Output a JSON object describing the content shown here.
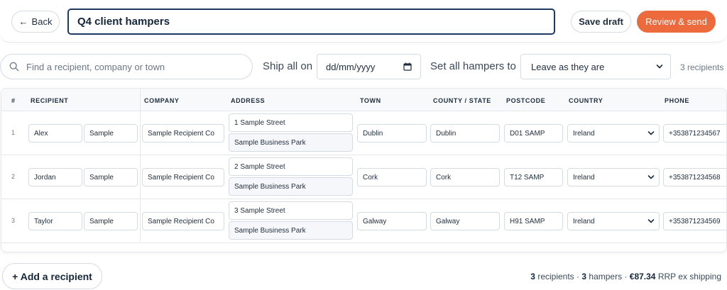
{
  "header": {
    "back_label": "Back",
    "back_arrow": "←",
    "title_value": "Q4 client hampers",
    "save_draft_label": "Save draft",
    "review_label": "Review & send",
    "accent_color": "#ec6a3c"
  },
  "toolbar": {
    "search_placeholder": "Find a recipient, company or town",
    "ship_label": "Ship all on",
    "date_placeholder": "dd/mm/yyyy",
    "set_all_label": "Set all hampers to",
    "set_all_value": "Leave as they are",
    "recipient_count": "3 recipients"
  },
  "table": {
    "columns": [
      "#",
      "RECIPIENT",
      "COMPANY",
      "ADDRESS",
      "TOWN",
      "COUNTY / STATE",
      "POSTCODE",
      "COUNTRY",
      "PHONE"
    ],
    "rows": [
      {
        "num": "1",
        "first": "Alex",
        "last": "Sample",
        "company": "Sample Recipient Co",
        "addr1": "1 Sample Street",
        "addr2": "Sample Business Park",
        "town": "Dublin",
        "county": "Dublin",
        "postcode": "D01 SAMP",
        "country": "Ireland",
        "phone": "+353871234567"
      },
      {
        "num": "2",
        "first": "Jordan",
        "last": "Sample",
        "company": "Sample Recipient Co",
        "addr1": "2 Sample Street",
        "addr2": "Sample Business Park",
        "town": "Cork",
        "county": "Cork",
        "postcode": "T12 SAMP",
        "country": "Ireland",
        "phone": "+353871234568"
      },
      {
        "num": "3",
        "first": "Taylor",
        "last": "Sample",
        "company": "Sample Recipient Co",
        "addr1": "3 Sample Street",
        "addr2": "Sample Business Park",
        "town": "Galway",
        "county": "Galway",
        "postcode": "H91 SAMP",
        "country": "Ireland",
        "phone": "+353871234569"
      }
    ]
  },
  "footer": {
    "add_label": "+ Add a recipient",
    "recipients_num": "3",
    "recipients_word": "recipients",
    "separator": "·",
    "hampers_num": "3",
    "hampers_word": "hampers",
    "total": "€87.34",
    "total_suffix": "RRP ex shipping"
  }
}
